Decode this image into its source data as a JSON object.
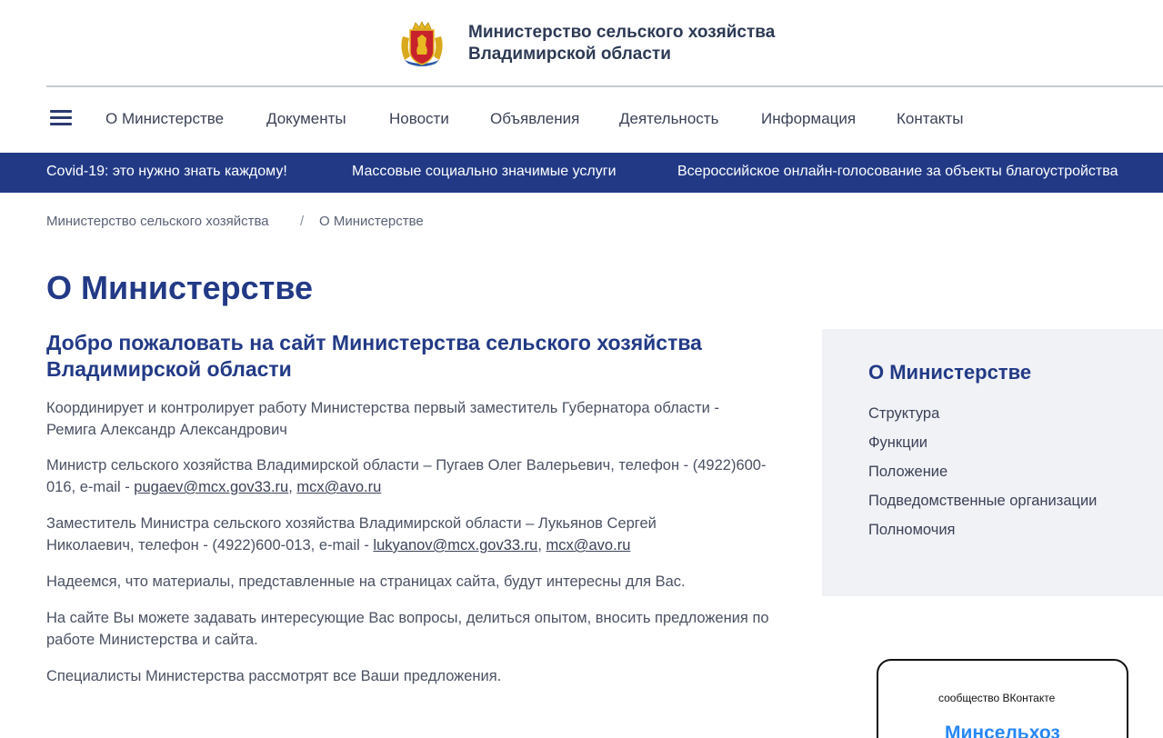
{
  "header": {
    "title_line1": "Министерство сельского хозяйства",
    "title_line2": "Владимирской области"
  },
  "nav": {
    "menu_icon": "hamburger-menu-icon",
    "items": [
      "О Министерстве",
      "Документы",
      "Новости",
      "Объявления",
      "Деятельность",
      "Информация",
      "Контакты"
    ]
  },
  "banner": {
    "items": [
      "Covid-19: это нужно знать каждому!",
      "Массовые социально значимые услуги",
      "Всероссийское онлайн-голосование за объекты благоустройства"
    ]
  },
  "breadcrumb": {
    "home": "Министерство сельского хозяйства",
    "separator": "/",
    "current": "О Министерстве"
  },
  "page": {
    "title": "О Министерстве",
    "welcome_line1": "Добро пожаловать на сайт Министерства сельского хозяйства",
    "welcome_line2": "Владимирской области",
    "p1_line1": "Координирует и контролирует работу Министерства первый заместитель Губернатора области -",
    "p1_line2": "Ремига Александр Александрович",
    "p2_line1": "Министр сельского хозяйства Владимирской области – Пугаев Олег Валерьевич, телефон - (4922)600-",
    "p2_line2_prefix": "016, e-mail - ",
    "p2_email1": "pugaev@mcx.gov33.ru",
    "p2_email2": " mcx@avo.ru",
    "p3_line1": "Заместитель Министра сельского хозяйства Владимирской области – Лукьянов Сергей",
    "p3_line2_prefix": "Николаевич, телефон - (4922)600-013, e-mail - ",
    "p3_email1": "lukyanov@mcx.gov33.ru",
    "p3_email2": " mcx@avo.ru",
    "p4": "Надеемся, что материалы, представленные на страницах сайта, будут интересны для Вас.",
    "p5_line1": "На сайте Вы можете задавать интересующие Вас вопросы, делиться опытом, вносить предложения по",
    "p5_line2": "работе Министерства и сайта.",
    "p6": "Специалисты Министерства рассмотрят все Ваши предложения."
  },
  "sidebar": {
    "title": "О Министерстве",
    "links": [
      "Структура",
      "Функции",
      "Положение",
      "Подведомственные организации",
      "Полномочия"
    ]
  },
  "vk_widget": {
    "caption": "сообщество ВКонтакте",
    "name": "Минсельхоз"
  },
  "colors": {
    "brand_blue": "#223a86",
    "sidebar_bg": "#f1f2f6",
    "vk_blue": "#2787f5"
  }
}
